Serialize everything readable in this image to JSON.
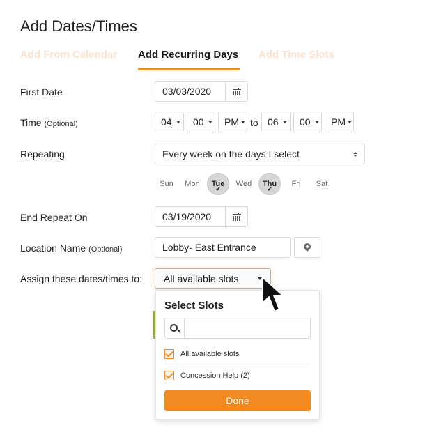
{
  "page": {
    "title": "Add Dates/Times"
  },
  "tabs": [
    {
      "label": "Add From Calendar",
      "active": false
    },
    {
      "label": "Add Recurring Days",
      "active": true
    },
    {
      "label": "Add Time Slots",
      "active": false
    }
  ],
  "form": {
    "first_date": {
      "label": "First Date",
      "value": "03/03/2020",
      "icon": "calendar-icon"
    },
    "time": {
      "label": "Time",
      "optional": "(Optional)",
      "start_hour": "04",
      "start_minute": "00",
      "start_ampm": "PM",
      "separator": "to",
      "end_hour": "06",
      "end_minute": "00",
      "end_ampm": "PM"
    },
    "repeating": {
      "label": "Repeating",
      "value": "Every week on the days I select"
    },
    "days": [
      {
        "label": "Sun",
        "selected": false
      },
      {
        "label": "Mon",
        "selected": false
      },
      {
        "label": "Tue",
        "selected": true
      },
      {
        "label": "Wed",
        "selected": false
      },
      {
        "label": "Thu",
        "selected": true
      },
      {
        "label": "Fri",
        "selected": false
      },
      {
        "label": "Sat",
        "selected": false
      }
    ],
    "check_glyph": "✔",
    "end_repeat": {
      "label": "End Repeat On",
      "value": "03/19/2020",
      "icon": "calendar-icon"
    },
    "location": {
      "label": "Location Name",
      "optional": "(Optional)",
      "value": "Lobby- East Entrance",
      "icon": "map-pin-icon"
    },
    "assign": {
      "label": "Assign these dates/times to:",
      "value": "All available slots"
    }
  },
  "dropdown": {
    "title": "Select Slots",
    "search_placeholder": "",
    "search_value": "",
    "items": [
      {
        "label": "All available slots",
        "checked": true
      },
      {
        "label": "Concession Help (2)",
        "checked": true
      }
    ],
    "done_label": "Done"
  },
  "colors": {
    "accent": "#f28a22",
    "tab_inactive": "#fbe3cf",
    "green_indicator": "#9bb64a"
  }
}
